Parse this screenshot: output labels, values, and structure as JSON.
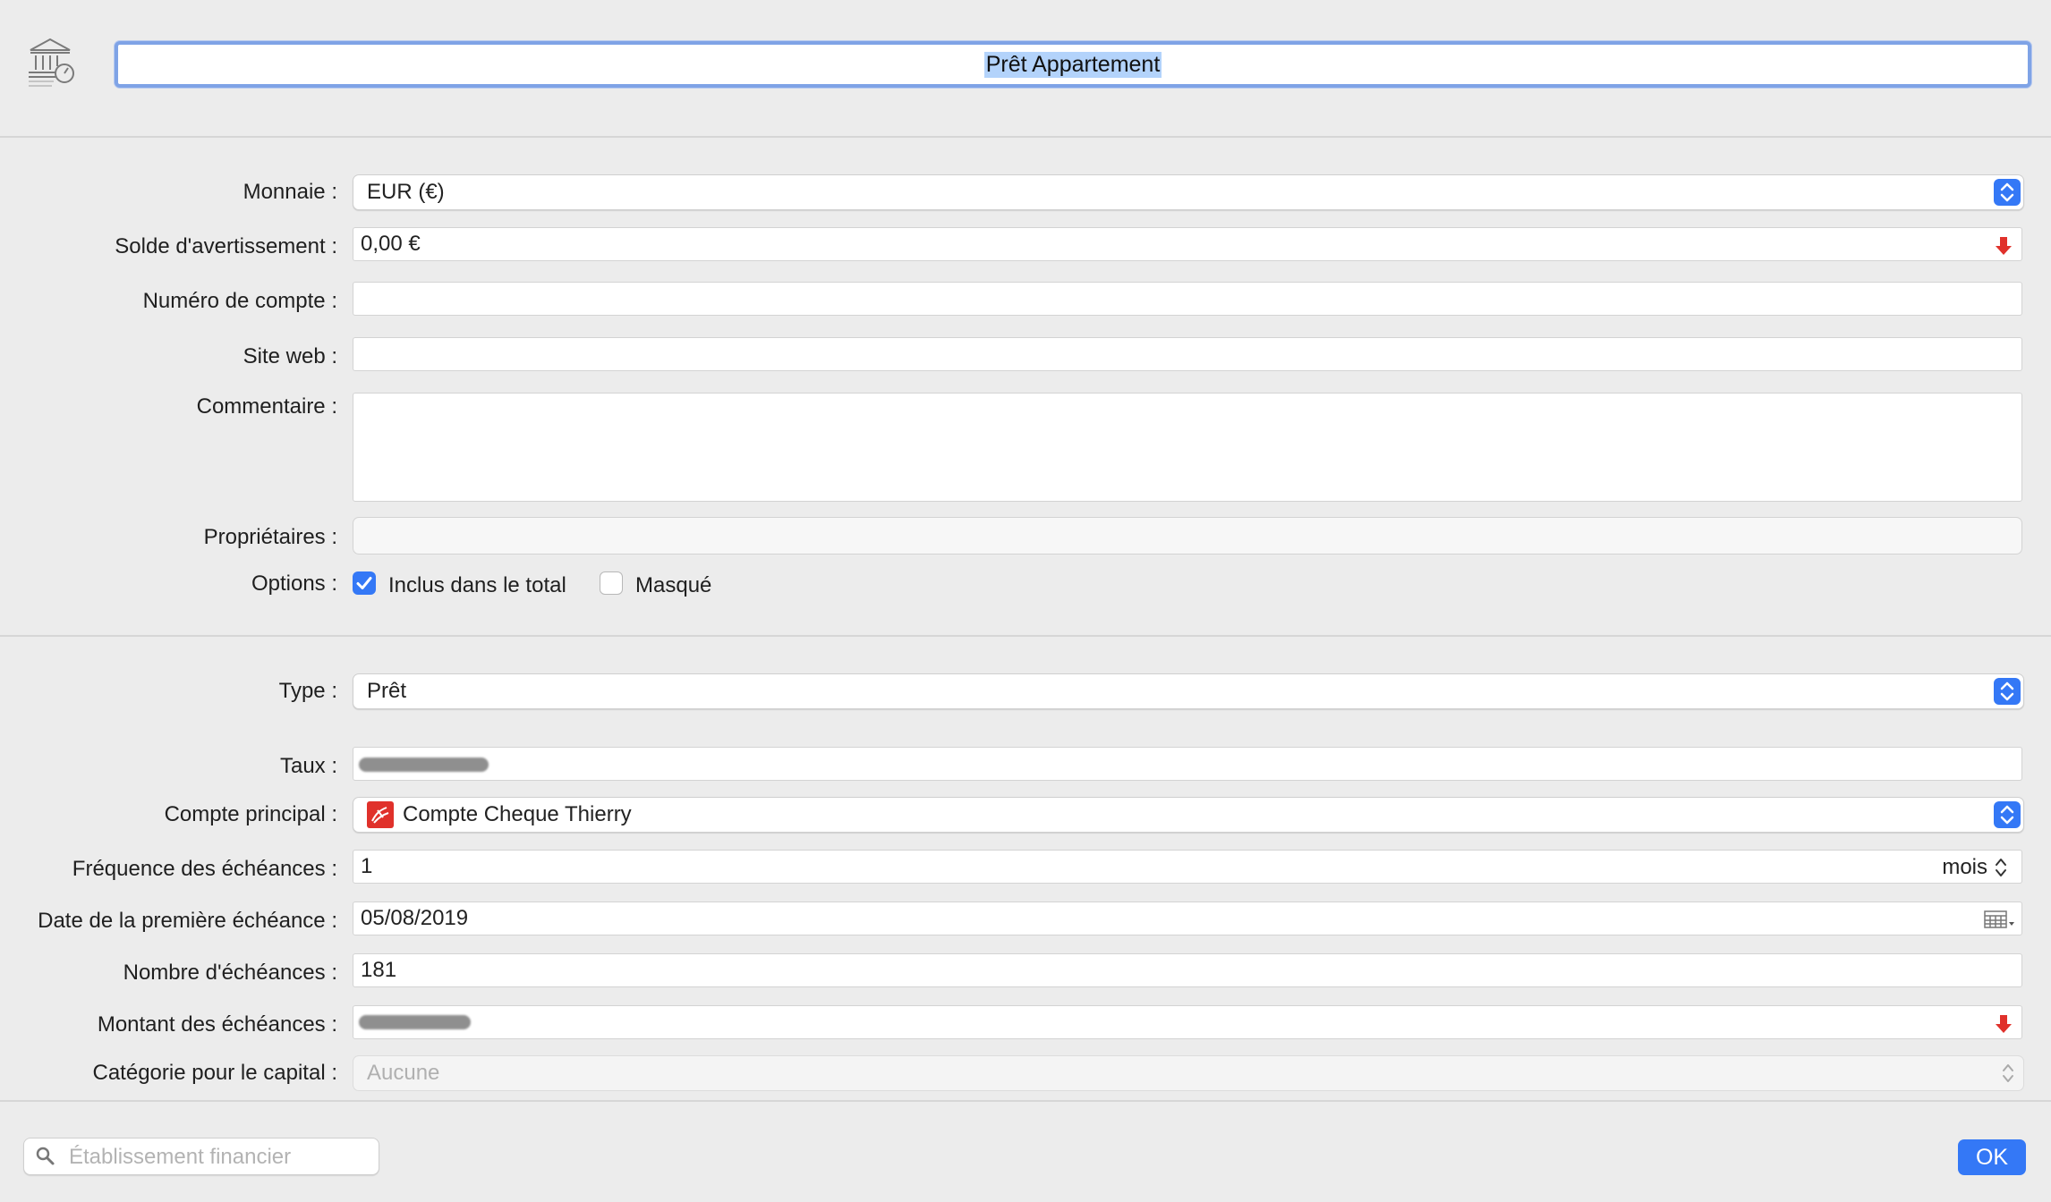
{
  "title_field": {
    "value": "Prêt Appartement"
  },
  "general": {
    "currency": {
      "label": "Monnaie :",
      "value": "EUR (€)"
    },
    "warning_balance": {
      "label": "Solde d'avertissement :",
      "value": "0,00 €"
    },
    "account_number": {
      "label": "Numéro de compte :",
      "value": ""
    },
    "website": {
      "label": "Site web :",
      "value": ""
    },
    "comment": {
      "label": "Commentaire :",
      "value": ""
    },
    "owners": {
      "label": "Propriétaires :",
      "value": ""
    },
    "options": {
      "label": "Options :",
      "included_in_total": {
        "label": "Inclus dans le total",
        "checked": true
      },
      "hidden": {
        "label": "Masqué",
        "checked": false
      }
    }
  },
  "loan": {
    "type": {
      "label": "Type :",
      "value": "Prêt"
    },
    "rate": {
      "label": "Taux :"
    },
    "main_account": {
      "label": "Compte principal :",
      "value": "Compte Cheque Thierry"
    },
    "frequency": {
      "label": "Fréquence des échéances :",
      "value": "1",
      "unit": "mois"
    },
    "first_due_date": {
      "label": "Date de la première échéance :",
      "value": "05/08/2019"
    },
    "installments_count": {
      "label": "Nombre d'échéances :",
      "value": "181"
    },
    "installment_amount": {
      "label": "Montant des échéances :"
    },
    "capital_category": {
      "label": "Catégorie pour le capital :",
      "value": "Aucune"
    }
  },
  "bottom": {
    "search": {
      "placeholder": "Établissement financier"
    },
    "ok_label": "OK"
  },
  "colors": {
    "accent": "#3478f6",
    "negative_arrow": "#e0312b",
    "title_selection": "#b3d3fb"
  }
}
